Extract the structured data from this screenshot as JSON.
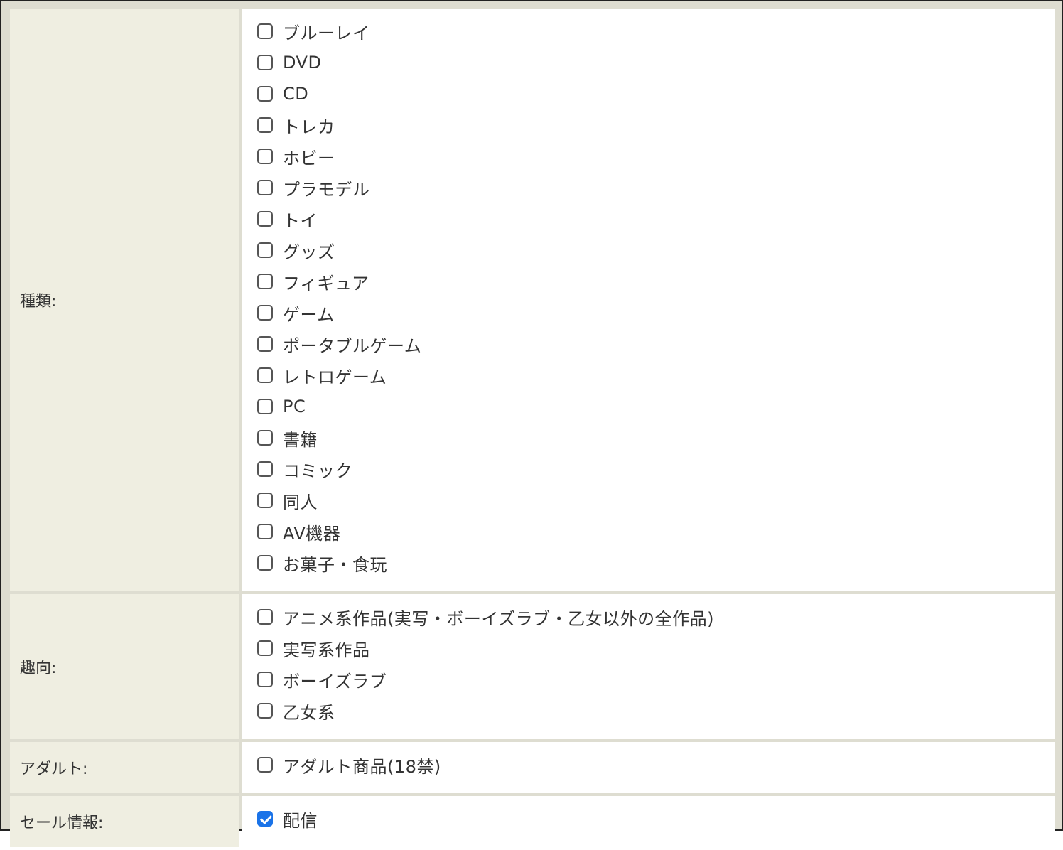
{
  "sections": [
    {
      "label": "種類:",
      "options": [
        {
          "label": "ブルーレイ",
          "checked": false
        },
        {
          "label": "DVD",
          "checked": false
        },
        {
          "label": "CD",
          "checked": false
        },
        {
          "label": "トレカ",
          "checked": false
        },
        {
          "label": "ホビー",
          "checked": false
        },
        {
          "label": "プラモデル",
          "checked": false
        },
        {
          "label": "トイ",
          "checked": false
        },
        {
          "label": "グッズ",
          "checked": false
        },
        {
          "label": "フィギュア",
          "checked": false
        },
        {
          "label": "ゲーム",
          "checked": false
        },
        {
          "label": "ポータブルゲーム",
          "checked": false
        },
        {
          "label": "レトロゲーム",
          "checked": false
        },
        {
          "label": "PC",
          "checked": false
        },
        {
          "label": "書籍",
          "checked": false
        },
        {
          "label": "コミック",
          "checked": false
        },
        {
          "label": "同人",
          "checked": false
        },
        {
          "label": "AV機器",
          "checked": false
        },
        {
          "label": "お菓子・食玩",
          "checked": false
        }
      ]
    },
    {
      "label": "趣向:",
      "options": [
        {
          "label": "アニメ系作品(実写・ボーイズラブ・乙女以外の全作品)",
          "checked": false
        },
        {
          "label": "実写系作品",
          "checked": false
        },
        {
          "label": "ボーイズラブ",
          "checked": false
        },
        {
          "label": "乙女系",
          "checked": false
        }
      ]
    },
    {
      "label": "アダルト:",
      "options": [
        {
          "label": "アダルト商品(18禁)",
          "checked": false
        }
      ]
    },
    {
      "label": "セール情報:",
      "options": [
        {
          "label": "配信",
          "checked": true
        }
      ]
    }
  ]
}
